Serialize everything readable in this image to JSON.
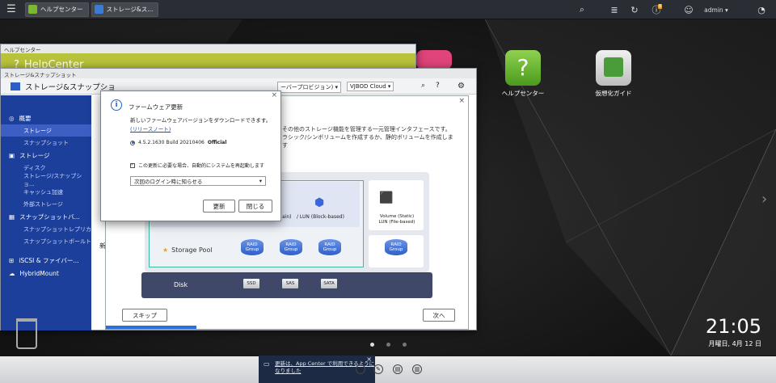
{
  "taskbar": {
    "tabs": [
      {
        "label": "ヘルプセンター"
      },
      {
        "label": "ストレージ&ス..."
      }
    ],
    "user": "admin ▾",
    "notification_count": "8"
  },
  "desktop": {
    "icons": [
      {
        "label": "ヘルプセンター"
      },
      {
        "label": "仮想化ガイド"
      }
    ],
    "clock_time": "21:05",
    "clock_date": "月曜日, 4月 12 日"
  },
  "helpcenter": {
    "window_title": "ヘルプセンター",
    "brand": "HelpCenter"
  },
  "storage": {
    "window_title": "ストレージ&スナップショット",
    "header_title": "ストレージ&スナップショ",
    "toolbar_provision": "ーバープロビジョン) ▾",
    "toolbar_vjbod": "VJBOD Cloud ▾",
    "sidebar": {
      "overview": "概要",
      "storage_item": "ストレージ",
      "snapshot_item": "スナップショット",
      "storage_group": "ストレージ",
      "disk": "ディスク",
      "storage_snapshot": "ストレージ/スナップショ...",
      "cache": "キャッシュ加速",
      "external": "外部ストレージ",
      "snapshot_group": "スナップショットバ...",
      "snapshot_replica": "スナップショットレプリカ",
      "snapshot_vault": "スナップショットボールト",
      "iscsi": "iSCSI & ファイバー...",
      "hybridmount": "HybridMount"
    },
    "body_fragment": "新"
  },
  "wizard": {
    "desc_line1": "その他のストレージ機能を管理する一元管理インタフェースです。",
    "desc_line2": "ラシック/シンボリュームを作成するか、静的ボリュームを作成しま",
    "desc_line3": "す",
    "lun_block": "/ LUN (Block-based)",
    "lun_fragment": "ain)",
    "volume_static": "Volume (Static)",
    "lun_file": "LUN (File-based)",
    "storage_pool": "Storage Pool",
    "raid_label": "RAID Group",
    "disk_label": "Disk",
    "disk_types": [
      "SSD",
      "SAS",
      "SATA"
    ],
    "skip_button": "スキップ",
    "next_button": "次へ"
  },
  "fw_dialog": {
    "title": "ファームウェア更新",
    "message": "新しいファームウェアバージョンをダウンロードできます。",
    "release_notes": "(リリースノート)",
    "version_prefix": "4.5.2.1630 Build 20210406",
    "version_suffix": "Official",
    "restart_option": "この更新に必要な場合、自動的にシステムを再起動します",
    "remind_select": "次回のログイン時に知らせる",
    "update_button": "更新",
    "close_button": "閉じる"
  },
  "notification": {
    "line1": "更新は、App Center で利用できるように",
    "line2": "なりました"
  }
}
